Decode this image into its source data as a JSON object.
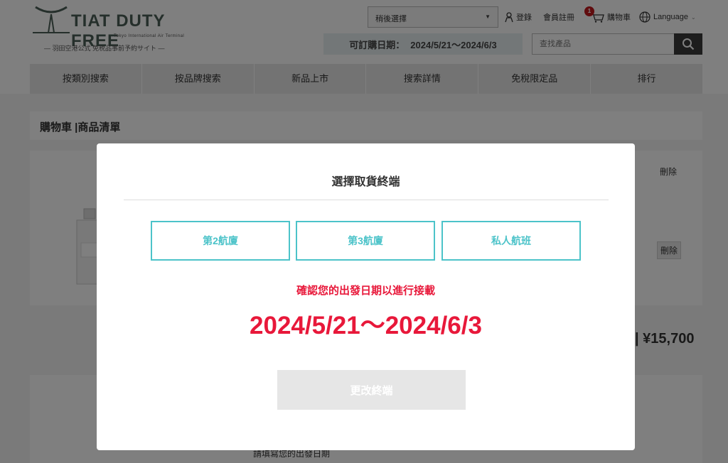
{
  "logo": {
    "brand": "TIAT DUTY FREE",
    "sub": "Tokyo International Air Terminal",
    "caption": "— 羽田空港公式 免税品事前予約サイト —"
  },
  "header": {
    "select_value": "稍後選擇",
    "login_label": "登錄",
    "register_label": "會員註冊",
    "cart_count": "1",
    "cart_label": "購物車",
    "language_label": "Language",
    "order_date_label": "可訂購日期：",
    "order_date_value": "2024/5/21〜2024/6/3",
    "search_placeholder": "查找產品"
  },
  "nav": {
    "items": [
      "按類別搜索",
      "按品牌搜索",
      "新品上市",
      "搜索詳情",
      "免稅限定品",
      "排行"
    ]
  },
  "page": {
    "title": "購物車 |商品清單",
    "delete_header": "刪除",
    "delete_button": "刪除",
    "total": "| ¥15,700",
    "lower_text": "請填寫您的出發日期"
  },
  "modal": {
    "title": "選擇取貨終端",
    "terminals": [
      "第2航廈",
      "第3航廈",
      "私人航班"
    ],
    "warning": "確認您的出發日期以進行接載",
    "date_range": "2024/5/21〜2024/6/3",
    "change_button": "更改終端"
  },
  "colors": {
    "accent_teal": "#4cc3c9",
    "warning_red": "#e8183a",
    "badge_red": "#c0181d"
  }
}
